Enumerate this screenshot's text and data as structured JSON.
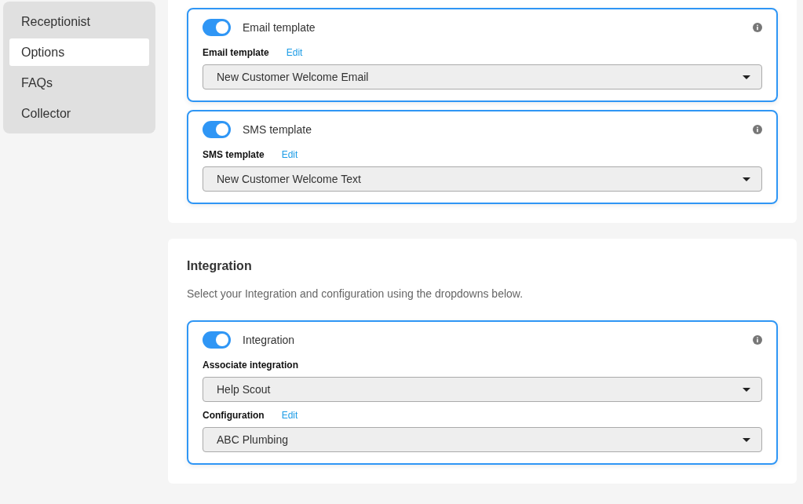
{
  "sidebar": {
    "items": [
      {
        "label": "Receptionist",
        "selected": false
      },
      {
        "label": "Options",
        "selected": true
      },
      {
        "label": "FAQs",
        "selected": false
      },
      {
        "label": "Collector",
        "selected": false
      }
    ]
  },
  "sections": [
    {
      "cards": [
        {
          "title": "Email template",
          "on": true,
          "fields": [
            {
              "label": "Email template",
              "link": "Edit",
              "value": "New Customer Welcome Email"
            }
          ]
        },
        {
          "title": "SMS template",
          "on": true,
          "fields": [
            {
              "label": "SMS template",
              "link": "Edit",
              "value": "New Customer Welcome Text"
            }
          ]
        }
      ]
    },
    {
      "title": "Integration",
      "description": "Select your Integration and configuration using the dropdowns below.",
      "cards": [
        {
          "title": "Integration",
          "on": true,
          "fields": [
            {
              "label": "Associate integration",
              "value": "Help Scout"
            },
            {
              "label": "Configuration",
              "link": "Edit",
              "value": "ABC Plumbing"
            }
          ]
        }
      ]
    }
  ]
}
